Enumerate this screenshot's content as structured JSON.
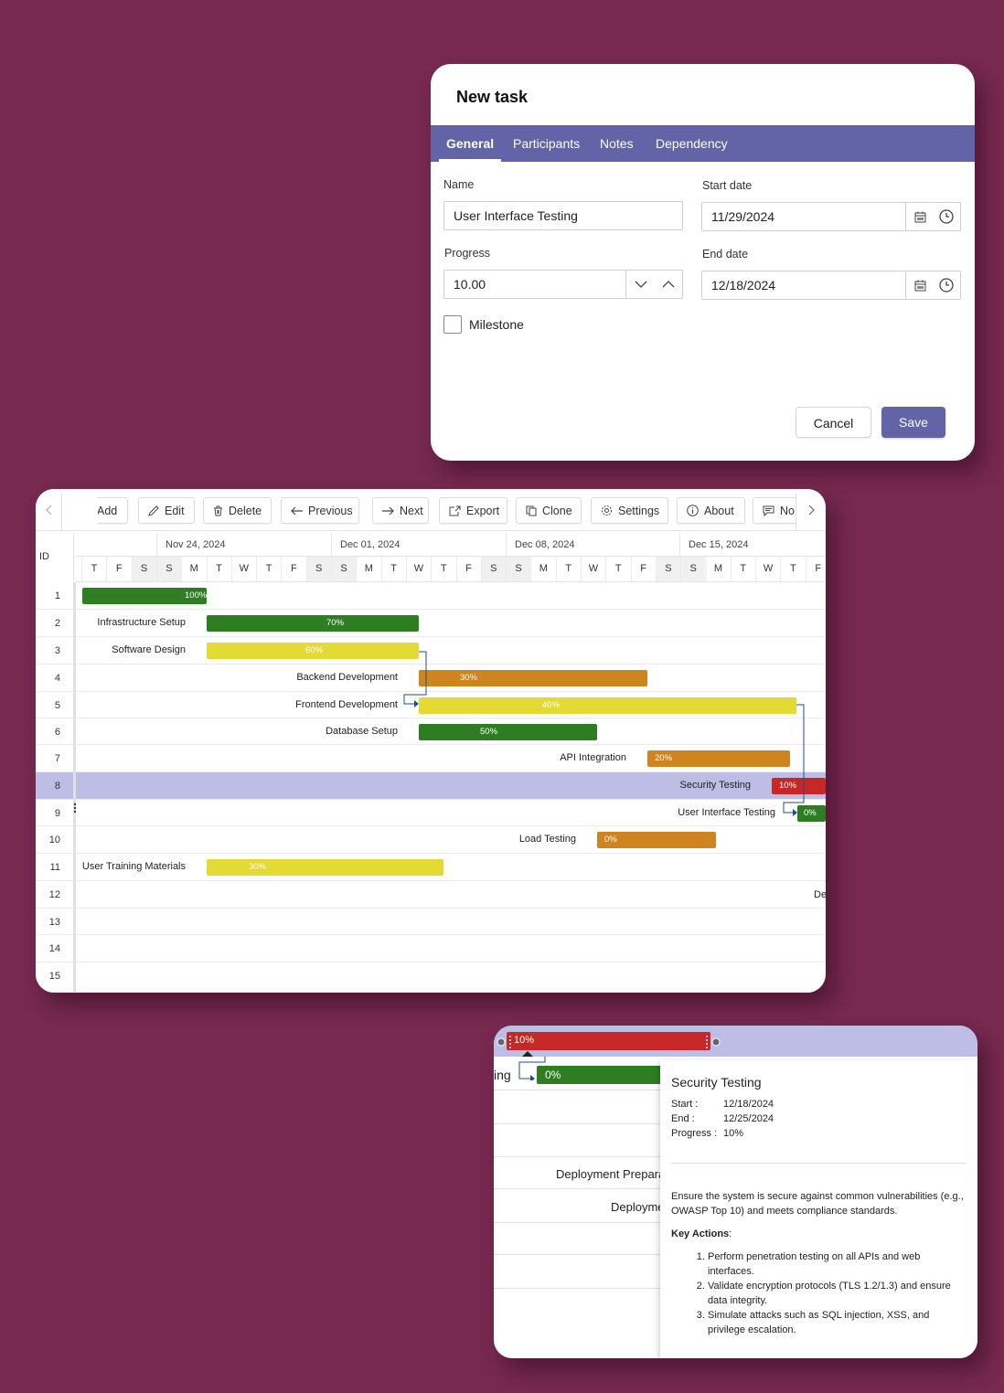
{
  "dialog": {
    "title": "New task",
    "tabs": [
      "General",
      "Participants",
      "Notes",
      "Dependency"
    ],
    "active_tab": "General",
    "name_label": "Name",
    "name_value": "User Interface Testing",
    "start_label": "Start date",
    "start_value": "11/29/2024",
    "progress_label": "Progress",
    "progress_value": "10.00",
    "end_label": "End date",
    "end_value": "12/18/2024",
    "milestone_label": "Milestone",
    "milestone_checked": false,
    "cancel_label": "Cancel",
    "save_label": "Save",
    "accent_color": "#6264a7"
  },
  "gantt": {
    "toolbar": [
      {
        "label": "Add",
        "icon": "plus-icon"
      },
      {
        "label": "Edit",
        "icon": "pencil-icon"
      },
      {
        "label": "Delete",
        "icon": "trash-icon"
      },
      {
        "label": "Previous",
        "icon": "arrow-left-icon"
      },
      {
        "label": "Next",
        "icon": "arrow-right-icon"
      },
      {
        "label": "Export",
        "icon": "export-icon"
      },
      {
        "label": "Clone",
        "icon": "copy-icon"
      },
      {
        "label": "Settings",
        "icon": "gear-icon"
      },
      {
        "label": "About",
        "icon": "info-icon"
      },
      {
        "label": "No",
        "icon": "note-icon"
      }
    ],
    "id_header": "ID",
    "weeks": [
      "Nov 24, 2024",
      "Dec 01, 2024",
      "Dec 08, 2024",
      "Dec 15, 2024"
    ],
    "days": [
      "T",
      "F",
      "S",
      "S",
      "M",
      "T",
      "W",
      "T",
      "F",
      "S",
      "S",
      "M",
      "T",
      "W",
      "T",
      "F",
      "S",
      "S",
      "M",
      "T",
      "W",
      "T",
      "F",
      "S",
      "S",
      "M",
      "T",
      "W",
      "T",
      "F"
    ],
    "row_ids": [
      "1",
      "2",
      "3",
      "4",
      "5",
      "6",
      "7",
      "8",
      "9",
      "10",
      "11",
      "12",
      "13",
      "14",
      "15"
    ],
    "selected_row": "8",
    "tasks": [
      {
        "id": "1",
        "name": "",
        "progress": "100%",
        "color": "#2e7d22"
      },
      {
        "id": "2",
        "name": "Infrastructure Setup",
        "progress": "70%",
        "color": "#2e7d22"
      },
      {
        "id": "3",
        "name": "Software Design",
        "progress": "60%",
        "color": "#e3da35"
      },
      {
        "id": "4",
        "name": "Backend Development",
        "progress": "30%",
        "color": "#d0841f"
      },
      {
        "id": "5",
        "name": "Frontend Development",
        "progress": "40%",
        "color": "#e3da35"
      },
      {
        "id": "6",
        "name": "Database Setup",
        "progress": "50%",
        "color": "#2e7d22"
      },
      {
        "id": "7",
        "name": "API Integration",
        "progress": "20%",
        "color": "#d0841f"
      },
      {
        "id": "8",
        "name": "Security Testing",
        "progress": "10%",
        "color": "#c62828"
      },
      {
        "id": "9",
        "name": "User Interface Testing",
        "progress": "0%",
        "color": "#2e7d22"
      },
      {
        "id": "10",
        "name": "Load Testing",
        "progress": "0%",
        "color": "#d0841f"
      },
      {
        "id": "11",
        "name": "User Training Materials",
        "progress": "30%",
        "color": "#e3da35"
      }
    ],
    "row12_clipped": "De"
  },
  "detail": {
    "bar_progress": "10%",
    "next_bar_progress": "0%",
    "clipped_label_ing": "ing",
    "clipped_deployment_prep": "Deployment Prepara",
    "clipped_deployment": "Deployme",
    "tooltip": {
      "title": "Security Testing",
      "start_key": "Start :",
      "start_value": "12/18/2024",
      "end_key": "End :",
      "end_value": "12/25/2024",
      "progress_key": "Progress :",
      "progress_value": "10%",
      "description": "Ensure the system is secure against common vulnerabilities (e.g., OWASP Top 10) and meets compliance standards.",
      "key_actions_label": "Key Actions",
      "key_actions_colon": ":",
      "actions": [
        "Perform penetration testing on all APIs and web interfaces.",
        "Validate encryption protocols (TLS 1.2/1.3) and ensure data integrity.",
        "Simulate attacks such as SQL injection, XSS, and privilege escalation."
      ]
    }
  }
}
